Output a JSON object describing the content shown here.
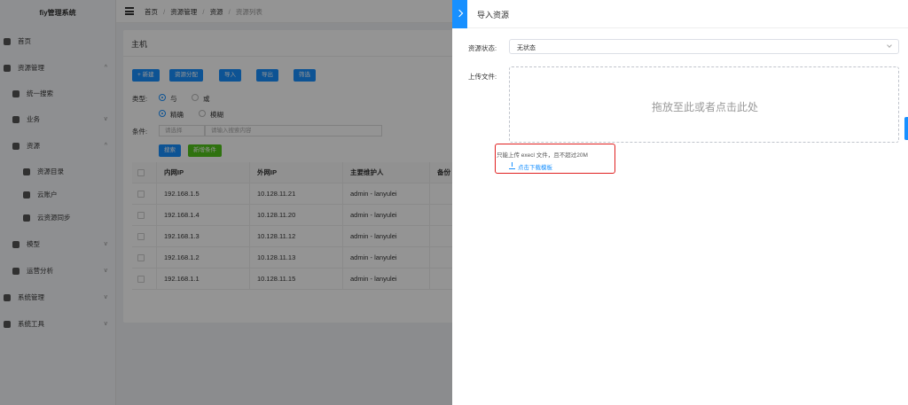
{
  "app": {
    "logo": "fiy管理系统"
  },
  "sidebar": {
    "items": [
      {
        "label": "首页",
        "level": 1,
        "arrow": ""
      },
      {
        "label": "资源管理",
        "level": 1,
        "arrow": "^"
      },
      {
        "label": "统一搜索",
        "level": 2,
        "arrow": ""
      },
      {
        "label": "业务",
        "level": 2,
        "arrow": "v"
      },
      {
        "label": "资源",
        "level": 2,
        "arrow": "^"
      },
      {
        "label": "资源目录",
        "level": 3,
        "arrow": ""
      },
      {
        "label": "云账户",
        "level": 3,
        "arrow": ""
      },
      {
        "label": "云资源同步",
        "level": 3,
        "arrow": ""
      },
      {
        "label": "模型",
        "level": 2,
        "arrow": "v"
      },
      {
        "label": "运营分析",
        "level": 2,
        "arrow": "v"
      },
      {
        "label": "系统管理",
        "level": 1,
        "arrow": "v"
      },
      {
        "label": "系统工具",
        "level": 1,
        "arrow": "v"
      }
    ]
  },
  "breadcrumb": {
    "items": [
      "首页",
      "资源管理",
      "资源",
      "资源列表"
    ],
    "sep": "/"
  },
  "card": {
    "title": "主机",
    "toolbar": [
      "+ 新建",
      "资源分配",
      "导入",
      "导出",
      "筛选"
    ],
    "type_label": "类型:",
    "type_opt1": "与",
    "type_opt2": "或",
    "match_opt1": "精确",
    "match_opt2": "模糊",
    "cond_label": "条件:",
    "cond_select_placeholder": "请选择",
    "cond_input_placeholder": "请输入搜索内容",
    "search_btn": "搜索",
    "add_cond_btn": "新增条件"
  },
  "table": {
    "headers": [
      "内网IP",
      "外网IP",
      "主要维护人",
      "备份"
    ],
    "rows": [
      [
        "192.168.1.5",
        "10.128.11.21",
        "admin - lanyulei"
      ],
      [
        "192.168.1.4",
        "10.128.11.20",
        "admin - lanyulei"
      ],
      [
        "192.168.1.3",
        "10.128.11.12",
        "admin - lanyulei"
      ],
      [
        "192.168.1.2",
        "10.128.11.13",
        "admin - lanyulei"
      ],
      [
        "192.168.1.1",
        "10.128.11.15",
        "admin - lanyulei"
      ]
    ]
  },
  "drawer": {
    "title": "导入资源",
    "status_label": "资源状态:",
    "status_value": "无状态",
    "upload_label": "上传文件:",
    "drop_hint": "拖放至此或者点击此处",
    "tip": "只能上传 execl 文件，且不超过20M",
    "download_link": "点击下载模板"
  },
  "colors": {
    "primary": "#1890ff",
    "highlight": "#e02020",
    "success": "#52c41a"
  }
}
